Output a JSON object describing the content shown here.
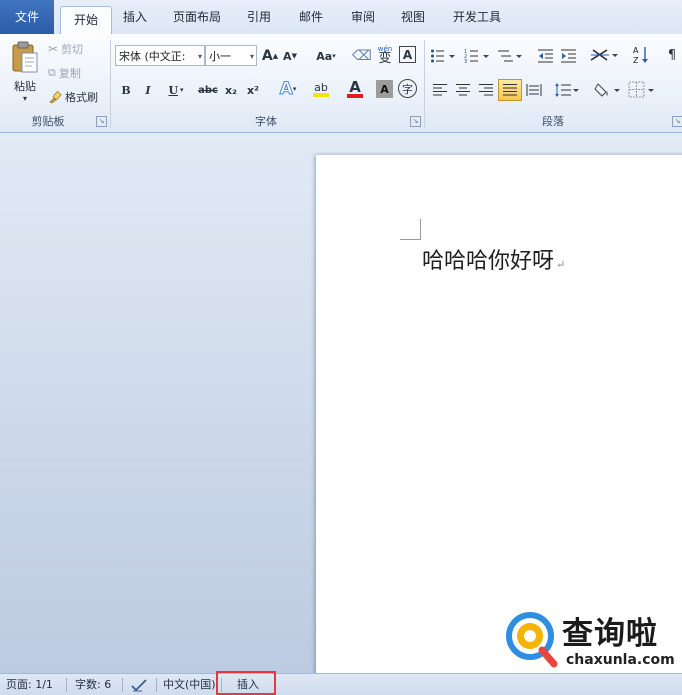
{
  "tabs": [
    "文件",
    "开始",
    "插入",
    "页面布局",
    "引用",
    "邮件",
    "审阅",
    "视图",
    "开发工具"
  ],
  "clipboard": {
    "paste": "粘贴",
    "cut": "剪切",
    "copy": "复制",
    "format_painter": "格式刷",
    "group_label": "剪贴板"
  },
  "font": {
    "font_name": "宋体 (中文正:",
    "font_size": "小一",
    "grow": "A",
    "shrink": "A",
    "change_case": "Aa",
    "clear_format": "字",
    "phonetic": "wén",
    "border_char": "A",
    "bold": "B",
    "italic": "I",
    "underline": "U",
    "strike": "abc",
    "subscript": "x₂",
    "superscript": "x²",
    "text_effect": "A",
    "highlight": "ab",
    "font_color": "A",
    "char_shading": "A",
    "enclose": "字",
    "group_label": "字体"
  },
  "paragraph": {
    "group_label": "段落"
  },
  "document": {
    "text": "哈哈哈你好呀",
    "para_mark": "↵"
  },
  "status": {
    "page": "页面: 1/1",
    "words": "字数: 6",
    "language": "中文(中国)",
    "mode": "插入"
  },
  "watermark": {
    "name": "查询啦",
    "url": "chaxunla.com"
  },
  "colors": {
    "accent": "#2a5da7",
    "highlight_box": "#e0393f",
    "font_color_bar": "#e21c1c",
    "highlight_bar": "#f5e400"
  }
}
